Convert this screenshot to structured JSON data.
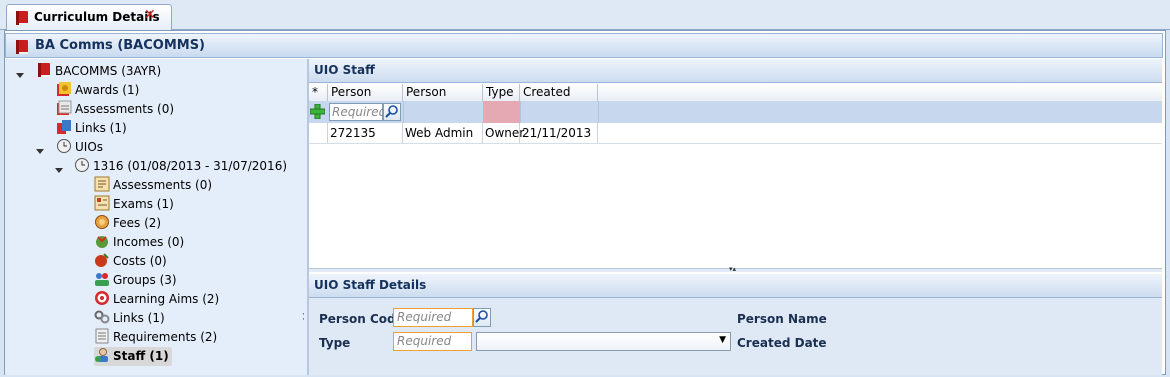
{
  "tab": {
    "title": "Curriculum Details",
    "close": "✕"
  },
  "header": {
    "title": "BA Comms (BACOMMS)"
  },
  "tree": {
    "root": "BACOMMS (3AYR)",
    "awards": "Awards (1)",
    "assessments": "Assessments (0)",
    "links": "Links (1)",
    "uios": "UIOs",
    "uio": "1316 (01/08/2013 - 31/07/2016)",
    "children": [
      "Assessments (0)",
      "Exams (1)",
      "Fees (2)",
      "Incomes (0)",
      "Costs (0)",
      "Groups (3)",
      "Learning Aims (2)",
      "Links (1)",
      "Requirements (2)",
      "Staff (1)"
    ]
  },
  "staff_grid": {
    "title": "UIO Staff",
    "columns": [
      "*",
      "Person Code",
      "Person Name",
      "Type",
      "Created Date"
    ],
    "new_row_placeholder": "Required",
    "rows": [
      {
        "person_code": "272135",
        "person_name": "Web Admin",
        "type": "Owner",
        "created_date": "21/11/2013"
      }
    ]
  },
  "details": {
    "title": "UIO Staff Details",
    "person_code_label": "Person Code",
    "person_code_placeholder": "Required",
    "person_name_label": "Person Name",
    "type_label": "Type",
    "type_placeholder": "Required",
    "created_date_label": "Created Date"
  },
  "colors": {
    "accent": "#15325c",
    "required_cell": "#e4a9b3",
    "add_icon": "#3cb43c"
  }
}
